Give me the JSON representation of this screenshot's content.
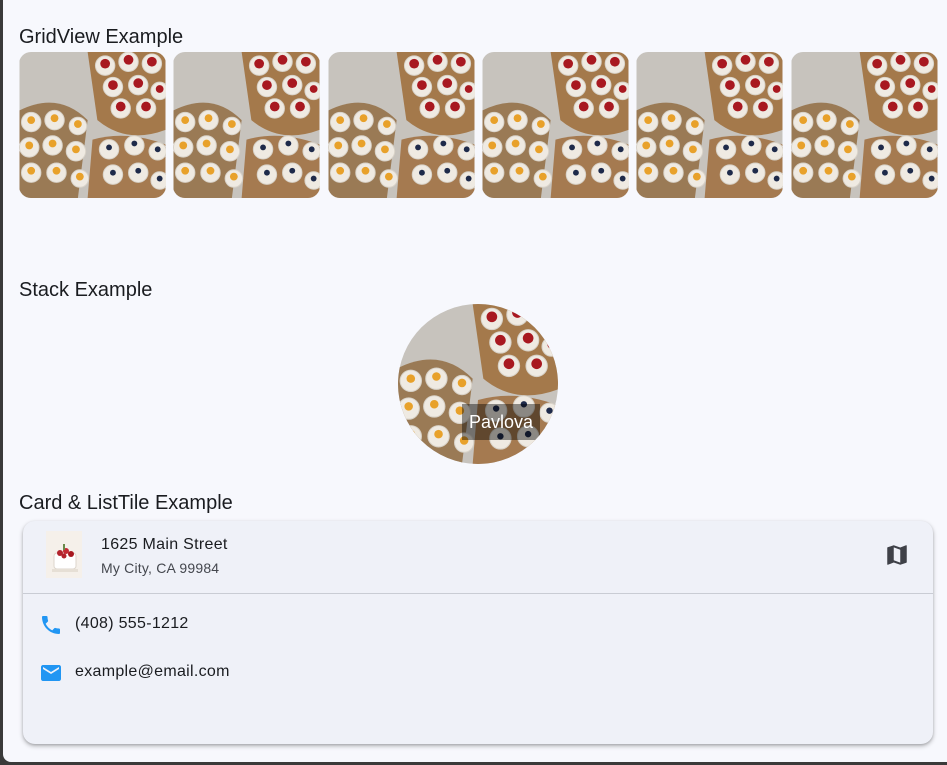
{
  "sections": {
    "grid_title": "GridView Example",
    "stack_title": "Stack Example",
    "card_title": "Card & ListTile Example"
  },
  "grid": {
    "tile_count": 6,
    "image": "pavlova-photo"
  },
  "stack": {
    "image": "pavlova-photo",
    "label": "Pavlova"
  },
  "card": {
    "leading_image": "pavlova-thumbnail",
    "title": "1625 Main Street",
    "subtitle": "My City, CA 99984",
    "trailing_icon": "map-icon",
    "phone": {
      "icon": "phone-icon",
      "text": "(408) 555-1212"
    },
    "email": {
      "icon": "email-icon",
      "text": "example@email.com"
    }
  },
  "colors": {
    "background": "#f7f8fd",
    "card": "#eff1f8",
    "accent_blue": "#2196f3",
    "text": "#1a1c20"
  }
}
